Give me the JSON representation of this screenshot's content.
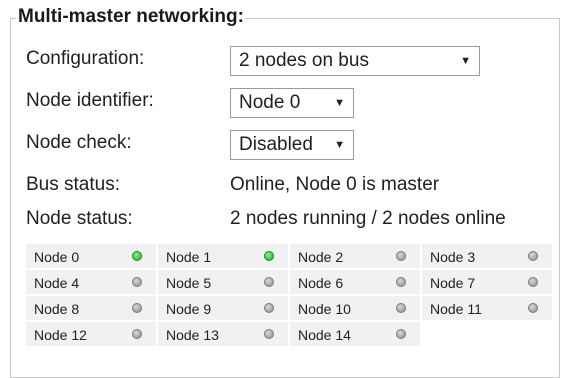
{
  "legend": "Multi-master networking:",
  "config": {
    "label": "Configuration:",
    "value": "2 nodes on bus"
  },
  "node_id": {
    "label": "Node identifier:",
    "value": "Node 0"
  },
  "node_check": {
    "label": "Node check:",
    "value": "Disabled"
  },
  "bus_status": {
    "label": "Bus status:",
    "value": "Online, Node 0 is master"
  },
  "node_status": {
    "label": "Node status:",
    "value": "2 nodes running / 2 nodes online"
  },
  "arrow": "▼",
  "colors": {
    "online": "#2ebd2e",
    "offline": "#9a9a9a",
    "cell_bg": "#f1f1f1"
  },
  "nodes": [
    {
      "label": "Node 0",
      "online": true
    },
    {
      "label": "Node 1",
      "online": true
    },
    {
      "label": "Node 2",
      "online": false
    },
    {
      "label": "Node 3",
      "online": false
    },
    {
      "label": "Node 4",
      "online": false
    },
    {
      "label": "Node 5",
      "online": false
    },
    {
      "label": "Node 6",
      "online": false
    },
    {
      "label": "Node 7",
      "online": false
    },
    {
      "label": "Node 8",
      "online": false
    },
    {
      "label": "Node 9",
      "online": false
    },
    {
      "label": "Node 10",
      "online": false
    },
    {
      "label": "Node 11",
      "online": false
    },
    {
      "label": "Node 12",
      "online": false
    },
    {
      "label": "Node 13",
      "online": false
    },
    {
      "label": "Node 14",
      "online": false
    }
  ]
}
